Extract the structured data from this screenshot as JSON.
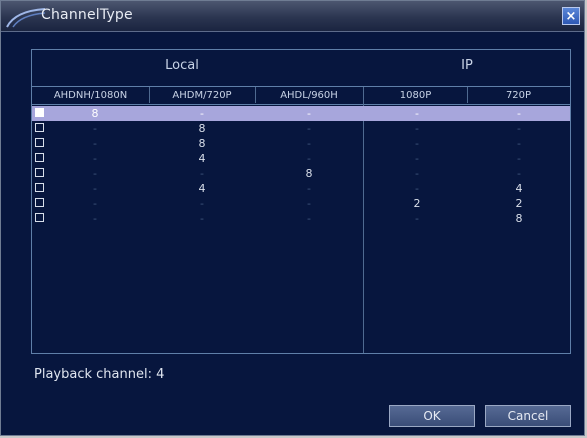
{
  "window": {
    "title": "ChannelType"
  },
  "groups": {
    "local": "Local",
    "ip": "IP"
  },
  "columns": [
    "AHDNH/1080N",
    "AHDM/720P",
    "AHDL/960H",
    "1080P",
    "720P"
  ],
  "rows": [
    {
      "selected": true,
      "cells": [
        "8",
        "-",
        "-",
        "-",
        "-"
      ]
    },
    {
      "selected": false,
      "cells": [
        "-",
        "8",
        "-",
        "-",
        "-"
      ]
    },
    {
      "selected": false,
      "cells": [
        "-",
        "8",
        "-",
        "-",
        "-"
      ]
    },
    {
      "selected": false,
      "cells": [
        "-",
        "4",
        "-",
        "-",
        "-"
      ]
    },
    {
      "selected": false,
      "cells": [
        "-",
        "-",
        "8",
        "-",
        "-"
      ]
    },
    {
      "selected": false,
      "cells": [
        "-",
        "4",
        "-",
        "-",
        "4"
      ]
    },
    {
      "selected": false,
      "cells": [
        "-",
        "-",
        "-",
        "2",
        "2"
      ]
    },
    {
      "selected": false,
      "cells": [
        "-",
        "-",
        "-",
        "-",
        "8"
      ]
    }
  ],
  "playback": {
    "text": "Playback channel: 4"
  },
  "buttons": {
    "ok": "OK",
    "cancel": "Cancel"
  },
  "icons": {
    "close": "close-icon"
  },
  "colors": {
    "window_bg": "#07163e",
    "selected_row": "#a7a6dc",
    "grid": "#5f7fa8"
  }
}
